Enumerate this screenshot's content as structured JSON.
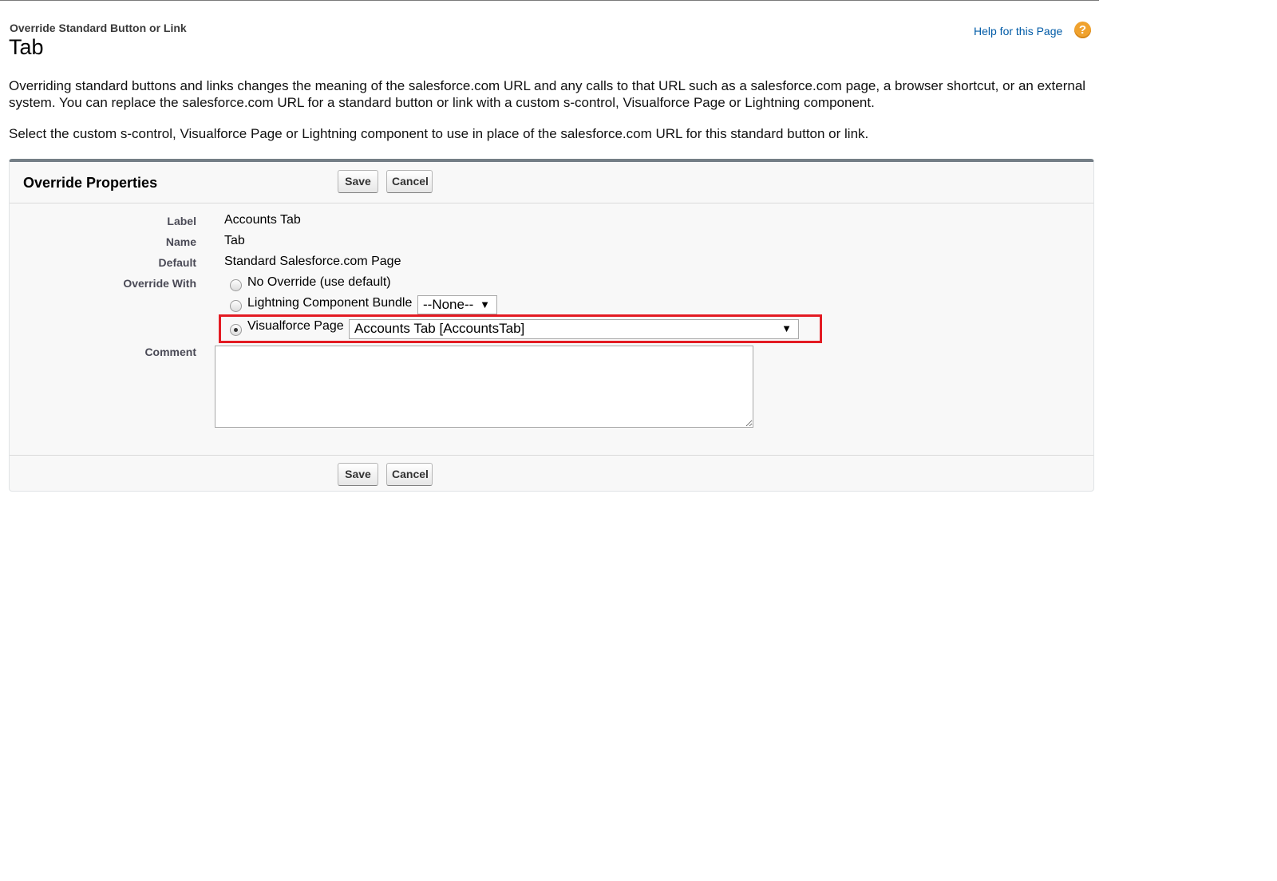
{
  "header": {
    "subtitle": "Override Standard Button or Link",
    "title": "Tab",
    "help_link": "Help for this Page",
    "help_icon": "?"
  },
  "description": {
    "p1": "Overriding standard buttons and links changes the meaning of the salesforce.com URL and any calls to that URL such as a salesforce.com page, a browser shortcut, or an external system. You can replace the salesforce.com URL for a standard button or link with a custom s-control, Visualforce Page or Lightning component.",
    "p2": "Select the custom s-control, Visualforce Page or Lightning component to use in place of the salesforce.com URL for this standard button or link."
  },
  "panel": {
    "title": "Override Properties",
    "save_label": "Save",
    "cancel_label": "Cancel",
    "fields": {
      "label_label": "Label",
      "label_value": "Accounts Tab",
      "name_label": "Name",
      "name_value": "Tab",
      "default_label": "Default",
      "default_value": "Standard Salesforce.com Page",
      "override_label": "Override With",
      "comment_label": "Comment"
    },
    "options": {
      "no_override": "No Override (use default)",
      "lightning": "Lightning Component Bundle",
      "lightning_selected": "--None--",
      "visualforce": "Visualforce Page",
      "visualforce_selected": "Accounts Tab [AccountsTab]"
    },
    "selected_option": "visualforce"
  },
  "colors": {
    "link": "#015ba7",
    "highlight_border": "#e31b23",
    "help_icon": "#f0a22e",
    "panel_top_border": "#747e86"
  },
  "icons": {
    "help": "help-circle-icon",
    "dropdown": "caret-down-icon"
  }
}
